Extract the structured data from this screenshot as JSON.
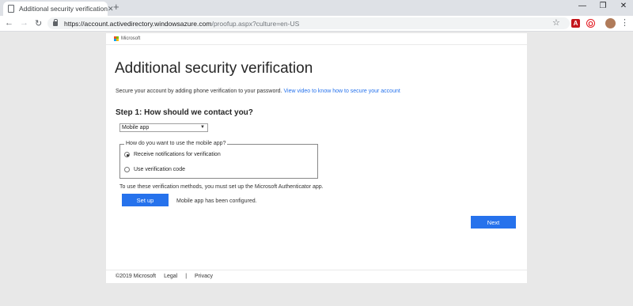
{
  "browser": {
    "tab_title": "Additional security verification",
    "tab_close": "✕",
    "new_tab": "+",
    "window_controls": {
      "minimize": "—",
      "restore": "❐",
      "close": "✕"
    },
    "nav": {
      "back": "←",
      "forward": "→",
      "reload": "↻"
    },
    "url_host": "https://account.activedirectory.windowsazure.com",
    "url_path": "/proofup.aspx?culture=en-US",
    "star_icon": "☆",
    "menu_icon": "⋮",
    "extensions": [
      {
        "name": "acrobat-extension-icon",
        "label": "A",
        "color": "#c4161c"
      },
      {
        "name": "opera-extension-icon",
        "label": "O",
        "color": "#e31c23"
      }
    ]
  },
  "page": {
    "brand": "Microsoft",
    "brand_colors": [
      "#f25022",
      "#7fba00",
      "#00a4ef",
      "#ffb900"
    ],
    "title": "Additional security verification",
    "intro_text": "Secure your account by adding phone verification to your password.",
    "intro_link": "View video to know how to secure your account",
    "step_heading": "Step 1: How should we contact you?",
    "contact_method": {
      "value": "Mobile app",
      "caret": "▼"
    },
    "mobile_app_group": {
      "legend": "How do you want to use the mobile app?",
      "options": [
        {
          "label": "Receive notifications for verification",
          "checked": true
        },
        {
          "label": "Use verification code",
          "checked": false
        }
      ]
    },
    "setup_note": "To use these verification methods, you must set up the Microsoft Authenticator app.",
    "setup_button": "Set up",
    "configured_status": "Mobile app has been configured.",
    "next_button": "Next",
    "footer": {
      "copyright": "©2019 Microsoft",
      "legal": "Legal",
      "separator": "|",
      "privacy": "Privacy"
    },
    "accent_color": "#2672ec"
  }
}
